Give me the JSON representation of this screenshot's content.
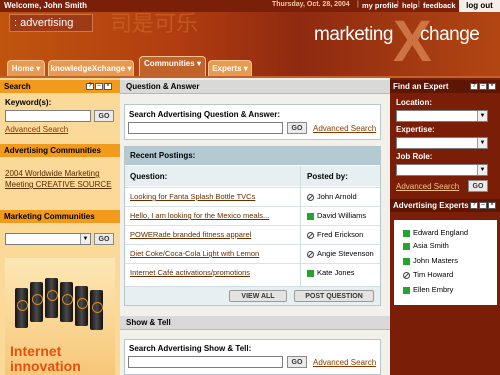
{
  "topbar": {
    "welcome": "Welcome, John Smith",
    "date": "Thursday, Oct. 28, 2004",
    "links": [
      "my profile",
      "help",
      "feedback"
    ],
    "logout": "log out"
  },
  "header": {
    "section": ": advertising",
    "brand_marketing": "marketing",
    "brand_x": "X",
    "brand_change": "change"
  },
  "nav": {
    "tabs": [
      {
        "label": "Home",
        "arrow": "▾"
      },
      {
        "label": "knowledgeXchange",
        "arrow": "▾"
      },
      {
        "label": "Communities",
        "arrow": "▾"
      },
      {
        "label": "Experts",
        "arrow": "▾"
      }
    ]
  },
  "left": {
    "search_title": "Search",
    "keyword_label": "Keyword(s):",
    "go": "GO",
    "advanced_search": "Advanced Search",
    "adv_comm_title": "Advertising Communities",
    "adv_comm_link": "2004 Worldwide Marketing Meeting CREATIVE SOURCE",
    "mkt_comm_title": "Marketing Communities",
    "ad_line1": "Internet",
    "ad_line2": "innovation"
  },
  "center": {
    "qa_title": "Question & Answer",
    "search_qa_label": "Search Advertising Question & Answer:",
    "go": "GO",
    "advanced_search": "Advanced Search",
    "recent_title": "Recent Postings:",
    "col_question": "Question:",
    "col_posted": "Posted by:",
    "rows": [
      {
        "q": "Looking for Fanta Splash Bottle TVCs",
        "by": "John Arnold",
        "status": "off"
      },
      {
        "q": "Hello, I am looking for the Mexico meals...",
        "by": "David Williams",
        "status": "on"
      },
      {
        "q": "POWERade branded fitness apparel",
        "by": "Fred Erickson",
        "status": "off"
      },
      {
        "q": "Diet Coke/Coca-Cola Light with Lemon",
        "by": "Angie Stevenson",
        "status": "off"
      },
      {
        "q": "Internet Café activations/promotions",
        "by": "Kate Jones",
        "status": "on"
      }
    ],
    "view_all": "VIEW ALL",
    "post_question": "POST QUESTION",
    "show_title": "Show & Tell",
    "search_show_label": "Search Advertising Show & Tell:"
  },
  "right": {
    "find_title": "Find an Expert",
    "location": "Location:",
    "expertise": "Expertise:",
    "job_role": "Job Role:",
    "advanced_search": "Advanced Search",
    "go": "GO",
    "experts_title": "Advertising Experts",
    "experts": [
      {
        "name": "Edward England",
        "status": "on"
      },
      {
        "name": "Asia Smith",
        "status": "on"
      },
      {
        "name": "John Masters",
        "status": "on"
      },
      {
        "name": "Tim Howard",
        "status": "off"
      },
      {
        "name": "Ellen Embry",
        "status": "on"
      }
    ]
  },
  "colors": {
    "topbar": "#7a1f08",
    "accent_orange": "#f29a1c",
    "right_panel": "#7b1e07",
    "online_green": "#22a52a"
  },
  "icons": [
    "help-icon",
    "minimize-icon",
    "close-icon",
    "online-status-icon",
    "offline-status-icon",
    "dropdown-arrow-icon"
  ]
}
